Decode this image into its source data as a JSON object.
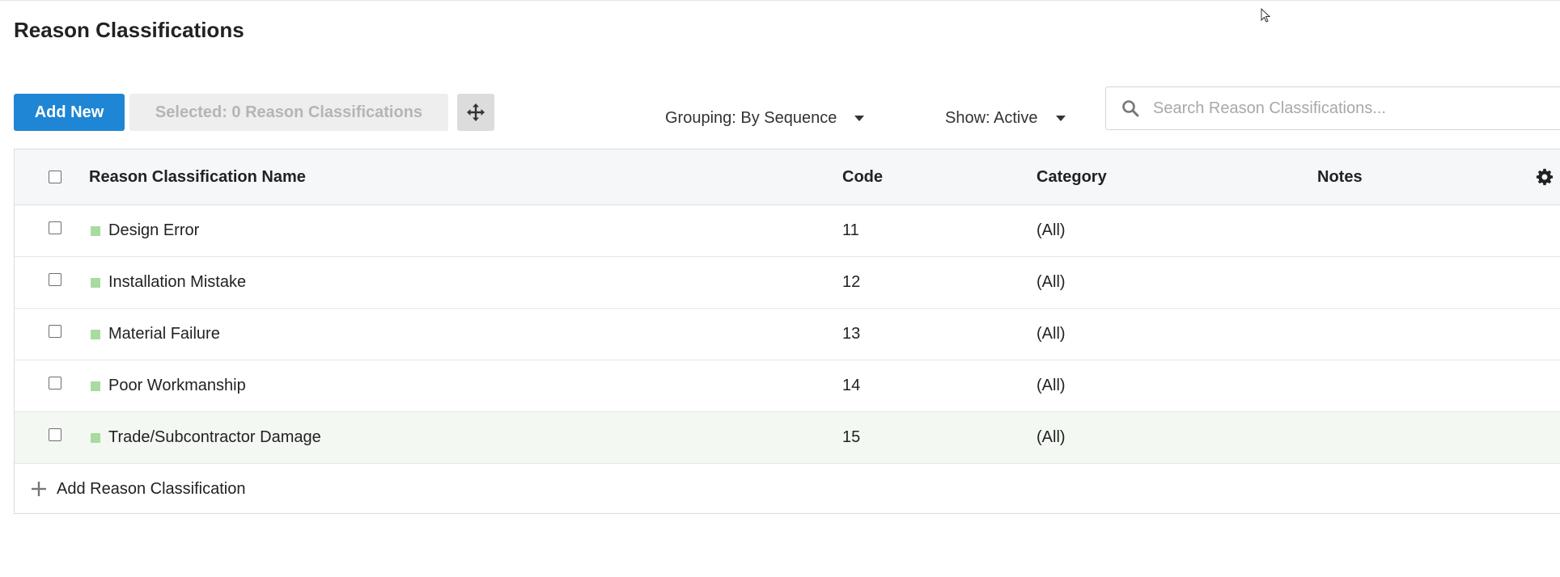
{
  "page": {
    "title": "Reason Classifications"
  },
  "toolbar": {
    "add_new_label": "Add New",
    "selected_label": "Selected: 0 Reason Classifications",
    "grouping_label": "Grouping: By Sequence",
    "show_label": "Show: Active",
    "search_placeholder": "Search Reason Classifications..."
  },
  "table": {
    "columns": {
      "name": "Reason Classification Name",
      "code": "Code",
      "category": "Category",
      "notes": "Notes"
    },
    "rows": [
      {
        "name": "Design Error",
        "code": "11",
        "category": "(All)",
        "notes": ""
      },
      {
        "name": "Installation Mistake",
        "code": "12",
        "category": "(All)",
        "notes": ""
      },
      {
        "name": "Material Failure",
        "code": "13",
        "category": "(All)",
        "notes": ""
      },
      {
        "name": "Poor Workmanship",
        "code": "14",
        "category": "(All)",
        "notes": ""
      },
      {
        "name": "Trade/Subcontractor Damage",
        "code": "15",
        "category": "(All)",
        "notes": ""
      }
    ],
    "add_row_label": "Add Reason Classification"
  },
  "colors": {
    "primary": "#1e86d4",
    "row_swatch": "#a8dba0",
    "highlight_row": "#f3f8f2",
    "header_bg": "#f6f7f9"
  },
  "icons": {
    "move": "move-arrows-icon",
    "search": "search-icon",
    "settings": "gear-icon",
    "add": "plus-icon",
    "dropdown": "caret-down-icon",
    "cursor": "mouse-pointer-icon"
  }
}
